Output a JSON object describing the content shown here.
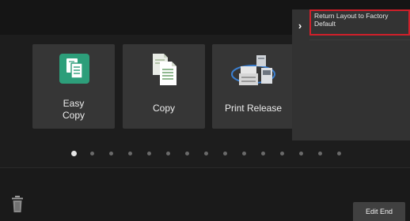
{
  "tiles": [
    {
      "label_line1": "Easy",
      "label_line2": "Copy"
    },
    {
      "label": "Copy"
    },
    {
      "label": "Print Release"
    }
  ],
  "side_menu": {
    "toggle_glyph": "›",
    "items": [
      {
        "label": "Return Layout to Factory Default"
      }
    ]
  },
  "pagination": {
    "pages": 15,
    "active_index": 0
  },
  "footer": {
    "edit_end_label": "Edit End",
    "trash_icon": "trash-icon"
  },
  "colors": {
    "accent_green": "#2d9e7a",
    "highlight_red": "#d11f2a",
    "tile_bg": "#363636"
  }
}
